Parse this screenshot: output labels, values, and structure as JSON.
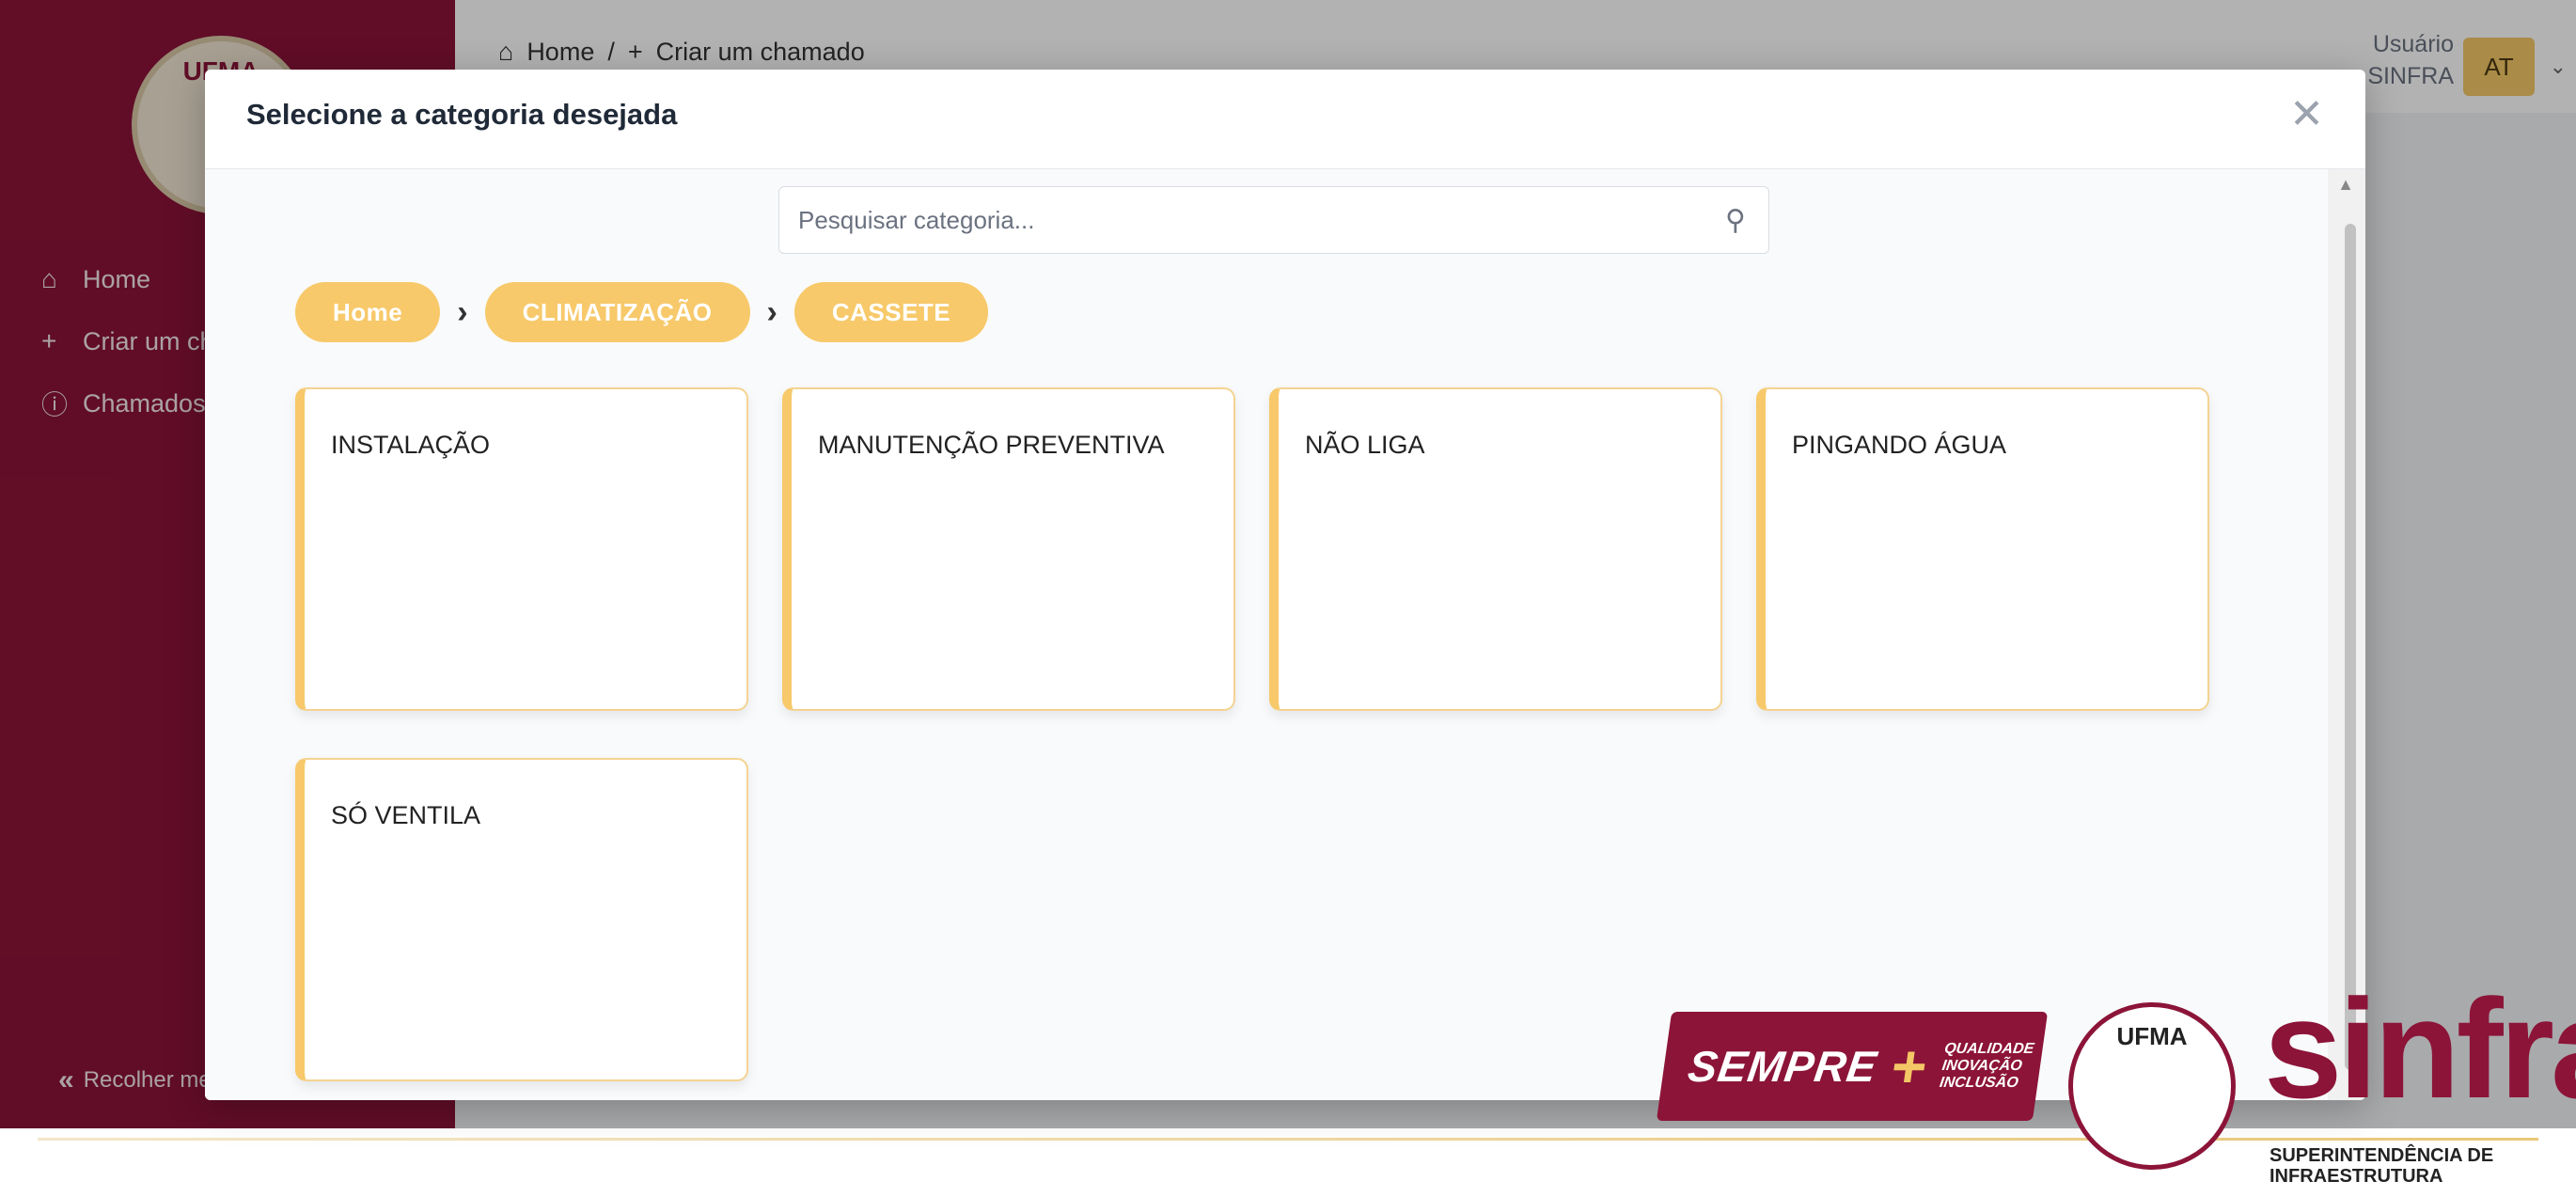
{
  "sidebar": {
    "logo_text": "UFMA",
    "items": [
      {
        "icon": "home-icon",
        "label": "Home"
      },
      {
        "icon": "plus-icon",
        "label": "Criar um chamado"
      },
      {
        "icon": "alert-circle-icon",
        "label": "Chamados"
      }
    ],
    "collapse_label": "Recolher menu"
  },
  "topbar": {
    "breadcrumb": [
      "Home",
      "/",
      "Criar um chamado"
    ],
    "user_label": "Usuário",
    "user_dept": "SINFRA",
    "avatar_initials": "AT"
  },
  "modal": {
    "title": "Selecione a categoria desejada",
    "search_placeholder": "Pesquisar categoria...",
    "breadcrumb": [
      "Home",
      "CLIMATIZAÇÃO",
      "CASSETE"
    ],
    "categories": [
      "INSTALAÇÃO",
      "MANUTENÇÃO PREVENTIVA",
      "NÃO LIGA",
      "PINGANDO ÁGUA",
      "SÓ VENTILA"
    ]
  },
  "footer": {
    "sempre": "SEMPRE",
    "sempre_tags": [
      "QUALIDADE",
      "INOVAÇÃO",
      "INCLUSÃO"
    ],
    "seal_text": "UFMA",
    "sinfra": "sinfra",
    "sinfra_sub": [
      "SUPERINTENDÊNCIA DE",
      "INFRAESTRUTURA"
    ]
  },
  "colors": {
    "brand": "#8c1438",
    "accent": "#f7c96a"
  }
}
